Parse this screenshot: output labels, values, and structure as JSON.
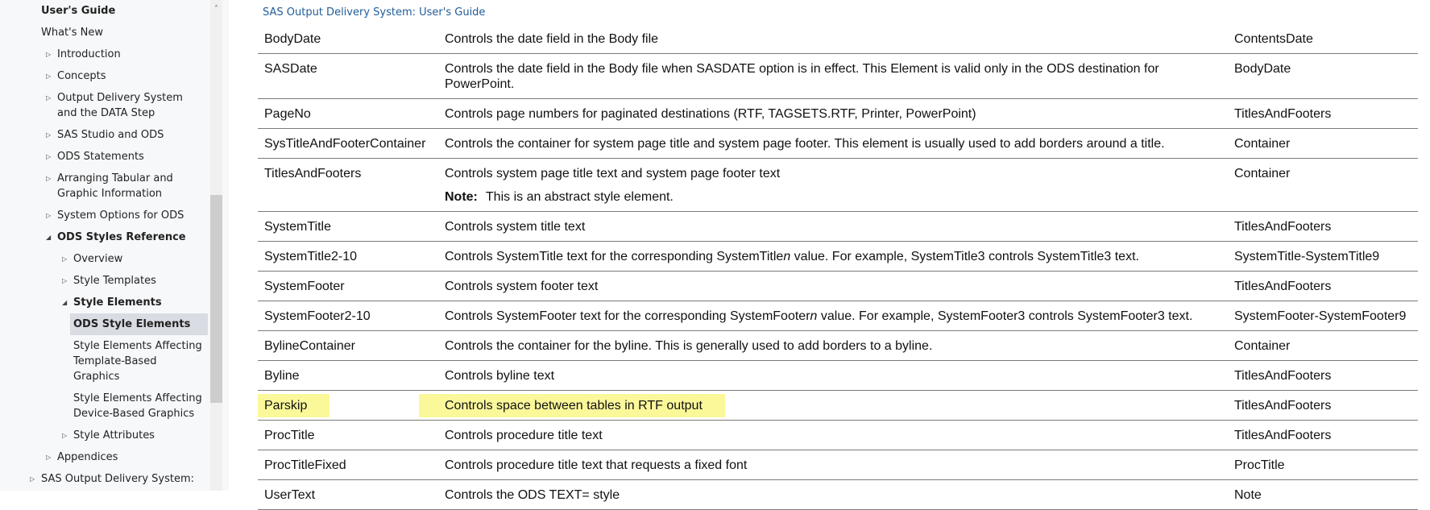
{
  "sidebar": {
    "scroll_up_icon": "chevron-up-icon",
    "items": [
      {
        "label": "User's Guide",
        "level": "l0",
        "bold": true,
        "arrow": ""
      },
      {
        "label": "What's New",
        "level": "l0",
        "arrow": ""
      },
      {
        "label": "Introduction",
        "level": "l1",
        "arrow": "▷"
      },
      {
        "label": "Concepts",
        "level": "l1",
        "arrow": "▷"
      },
      {
        "label": "Output Delivery System and the DATA Step",
        "level": "l1",
        "arrow": "▷"
      },
      {
        "label": "SAS Studio and ODS",
        "level": "l1",
        "arrow": "▷"
      },
      {
        "label": "ODS Statements",
        "level": "l1",
        "arrow": "▷"
      },
      {
        "label": "Arranging Tabular and Graphic Information",
        "level": "l1",
        "arrow": "▷"
      },
      {
        "label": "System Options for ODS",
        "level": "l1",
        "arrow": "▷"
      },
      {
        "label": "ODS Styles Reference",
        "level": "l1",
        "bold": true,
        "arrow": "◢"
      },
      {
        "label": "Overview",
        "level": "l2",
        "arrow": "▷"
      },
      {
        "label": "Style Templates",
        "level": "l2",
        "arrow": "▷"
      },
      {
        "label": "Style Elements",
        "level": "l2",
        "bold": true,
        "arrow": "◢"
      },
      {
        "label": "ODS Style Elements",
        "level": "l3",
        "bold": true,
        "selected": true,
        "arrow": ""
      },
      {
        "label": "Style Elements Affecting Template-Based Graphics",
        "level": "l3",
        "arrow": ""
      },
      {
        "label": "Style Elements Affecting Device-Based Graphics",
        "level": "l3",
        "arrow": ""
      },
      {
        "label": "Style Attributes",
        "level": "l2",
        "arrow": "▷"
      },
      {
        "label": "Appendices",
        "level": "l1",
        "arrow": "▷"
      },
      {
        "label": "SAS Output Delivery System:",
        "level": "l0",
        "arrow": "▷"
      }
    ]
  },
  "breadcrumb": "SAS Output Delivery System: User's Guide",
  "highlight_color": "#fbf89a",
  "table": {
    "rows": [
      {
        "element": "BodyDate",
        "description": "Controls the date field in the Body file",
        "parent": "ContentsDate"
      },
      {
        "element": "SASDate",
        "description": "Controls the date field in the Body file when SASDATE option is in effect. This Element is valid only in the ODS destination for PowerPoint.",
        "parent": "BodyDate"
      },
      {
        "element": "PageNo",
        "description": "Controls page numbers for paginated destinations (RTF, TAGSETS.RTF, Printer, PowerPoint)",
        "parent": "TitlesAndFooters"
      },
      {
        "element": "SysTitleAndFooterContainer",
        "description": "Controls the container for system page title and system page footer. This element is usually used to add borders around a title.",
        "parent": "Container"
      },
      {
        "element": "TitlesAndFooters",
        "description": "Controls system page title text and system page footer text",
        "parent": "Container",
        "note_label": "Note:",
        "note": "This is an abstract style element."
      },
      {
        "element": "SystemTitle",
        "description": "Controls system title text",
        "parent": "TitlesAndFooters"
      },
      {
        "element": "SystemTitle2-10",
        "description_pre": "Controls SystemTitle text for the corresponding SystemTitle",
        "description_italic": "n",
        "description_post": " value. For example, SystemTitle3 controls SystemTitle3 text.",
        "parent": "SystemTitle-SystemTitle9"
      },
      {
        "element": "SystemFooter",
        "description": "Controls system footer text",
        "parent": "TitlesAndFooters"
      },
      {
        "element": "SystemFooter2-10",
        "description_pre": "Controls SystemFooter text for the corresponding SystemFooter",
        "description_italic": "n",
        "description_post": " value. For example, SystemFooter3 controls SystemFooter3 text.",
        "parent": "SystemFooter-SystemFooter9"
      },
      {
        "element": "BylineContainer",
        "description": "Controls the container for the byline. This is generally used to add borders to a byline.",
        "parent": "Container"
      },
      {
        "element": "Byline",
        "description": "Controls byline text",
        "parent": "TitlesAndFooters"
      },
      {
        "element": "Parskip",
        "description": "Controls space between tables in RTF output",
        "parent": "TitlesAndFooters",
        "highlighted": true
      },
      {
        "element": "ProcTitle",
        "description": "Controls procedure title text",
        "parent": "TitlesAndFooters"
      },
      {
        "element": "ProcTitleFixed",
        "description": "Controls procedure title text that requests a fixed font",
        "parent": "ProcTitle"
      },
      {
        "element": "UserText",
        "description": "Controls the ODS TEXT= style",
        "parent": "Note"
      }
    ]
  }
}
